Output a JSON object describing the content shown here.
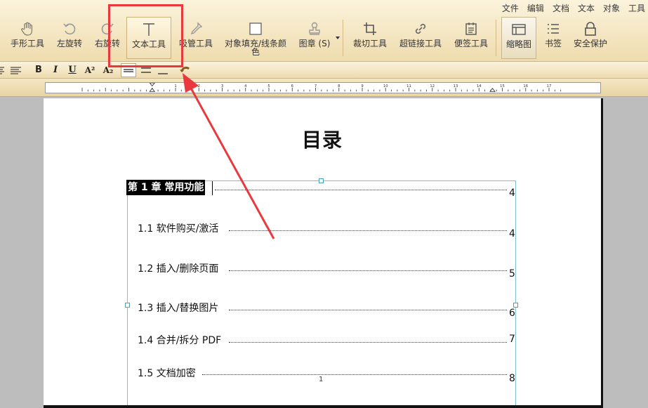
{
  "menu": [
    "文件",
    "编辑",
    "文档",
    "文本",
    "对象",
    "工具"
  ],
  "tools": [
    {
      "id": "hand",
      "label": "手形工具",
      "icon": "hand-icon"
    },
    {
      "id": "rotate-left",
      "label": "左旋转",
      "icon": "rotate-left-icon"
    },
    {
      "id": "rotate-right",
      "label": "右旋转",
      "icon": "rotate-right-icon"
    },
    {
      "id": "text",
      "label": "文本工具",
      "icon": "text-tool-icon"
    },
    {
      "id": "eyedropper",
      "label": "吸管工具",
      "icon": "eyedropper-icon"
    },
    {
      "id": "fill",
      "label": "对象填充/线条颜色",
      "icon": "fill-square-icon"
    },
    {
      "id": "stamp",
      "label": "图章 (S)",
      "icon": "stamp-icon"
    },
    {
      "id": "crop",
      "label": "裁切工具",
      "icon": "crop-icon"
    },
    {
      "id": "link",
      "label": "超链接工具",
      "icon": "link-icon"
    },
    {
      "id": "note",
      "label": "便签工具",
      "icon": "note-icon"
    },
    {
      "id": "thumbnail",
      "label": "缩略图",
      "icon": "thumbnail-icon"
    },
    {
      "id": "bookmark",
      "label": "书签",
      "icon": "bookmark-icon"
    },
    {
      "id": "security",
      "label": "安全保护",
      "icon": "lock-icon"
    }
  ],
  "format": {
    "bold": "B",
    "italic": "I",
    "underline": "U",
    "superscript": "A²",
    "subscript": "A₂"
  },
  "ruler_labels": [
    "1",
    "2",
    "3",
    "4",
    "5",
    "6",
    "7",
    "8",
    "9",
    "10",
    "11",
    "12",
    "13",
    "14",
    "15",
    "16",
    "17"
  ],
  "document": {
    "title": "目录",
    "chapter": {
      "label": "第 1 章  常用功能",
      "page": "4"
    },
    "entries": [
      {
        "label": "1.1 软件购买/激活",
        "page": "4"
      },
      {
        "label": "1.2 插入/删除页面",
        "page": "5"
      },
      {
        "label": "1.3 插入/替换图片",
        "page": "6"
      },
      {
        "label": "1.4 合并/拆分 PDF",
        "page": "7"
      },
      {
        "label": "1.5 文档加密",
        "page": "8"
      }
    ],
    "page_number": "1"
  },
  "colors": {
    "highlight": "#e9393f",
    "selection": "#7fc1cc",
    "toolbar": "#f3e3b8"
  }
}
